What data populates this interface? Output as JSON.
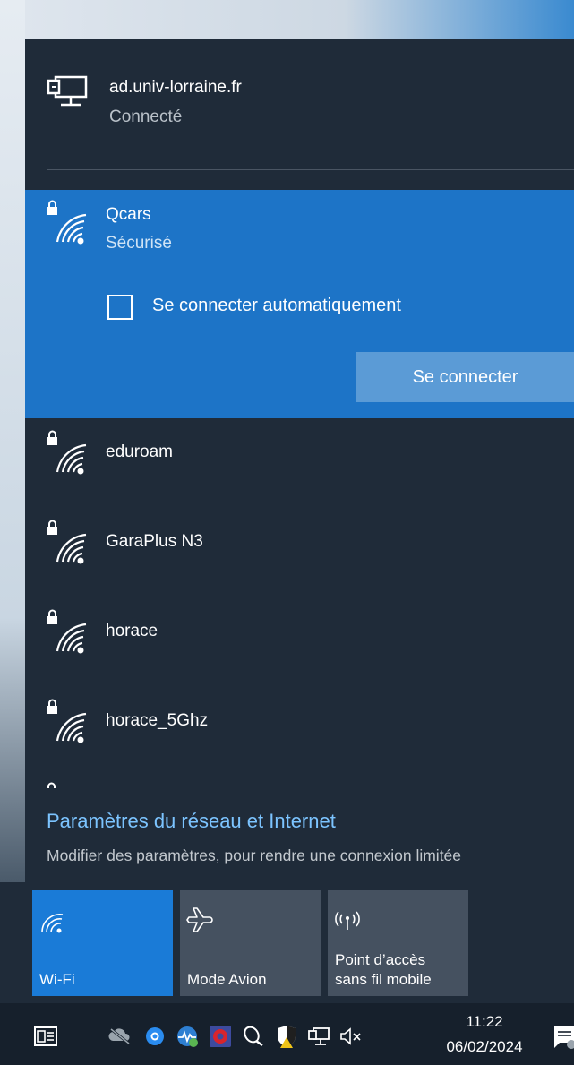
{
  "connected_network": {
    "name": "ad.univ-lorraine.fr",
    "status": "Connecté"
  },
  "selected_network": {
    "name": "Qcars",
    "status": "Sécurisé",
    "auto_connect_label": "Se connecter automatiquement",
    "auto_connect_checked": false,
    "connect_button": "Se connecter"
  },
  "networks": [
    {
      "name": "eduroam"
    },
    {
      "name": "GaraPlus N3"
    },
    {
      "name": "horace"
    },
    {
      "name": "horace_5Ghz"
    }
  ],
  "settings": {
    "title": "Paramètres du réseau et Internet",
    "subtitle": "Modifier des paramètres, pour rendre une connexion limitée"
  },
  "quick_actions": [
    {
      "label": "Wi-Fi",
      "icon": "wifi-icon",
      "active": true
    },
    {
      "label": "Mode Avion",
      "icon": "airplane-icon",
      "active": false
    },
    {
      "label": "Point d’accès\nsans fil mobile",
      "icon": "hotspot-icon",
      "active": false
    }
  ],
  "taskbar": {
    "time": "11:22",
    "date": "06/02/2024",
    "tray_icons": [
      "action-center-icon",
      "onedrive-icon",
      "edge-icon",
      "network-monitor-icon",
      "antivirus-icon",
      "mouse-icon",
      "security-icon",
      "network-icon",
      "volume-muted-icon",
      "notification-icon"
    ]
  },
  "colors": {
    "flyout_bg": "#1f2b39",
    "selected_bg": "#1d74c7",
    "active_tile": "#1a7bd7",
    "link": "#7cc4ff"
  }
}
